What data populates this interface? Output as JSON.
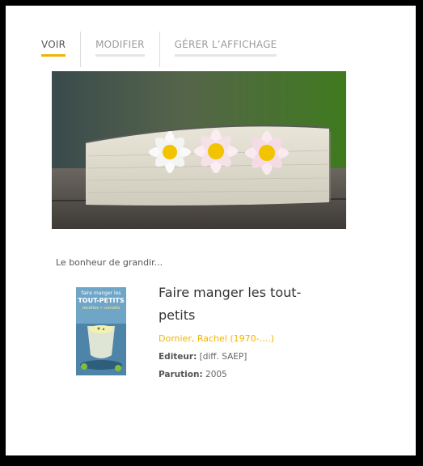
{
  "tabs": [
    {
      "label": "VOIR",
      "active": true
    },
    {
      "label": "MODIFIER",
      "active": false
    },
    {
      "label": "GÉRER L’AFFICHAGE",
      "active": false
    }
  ],
  "caption": "Le bonheur de grandir...",
  "book": {
    "title": "Faire manger les tout-petits",
    "author": "Dornier, Rachel (1970-....)",
    "editor_label": "Editeur:",
    "editor_value": "[diff. SAEP]",
    "date_label": "Parution:",
    "date_value": "2005",
    "cover_text": {
      "line1": "faire manger les",
      "line2": "TOUT-PETITS",
      "line3": "recettes • conseils"
    }
  },
  "colors": {
    "accent": "#f0b400"
  }
}
